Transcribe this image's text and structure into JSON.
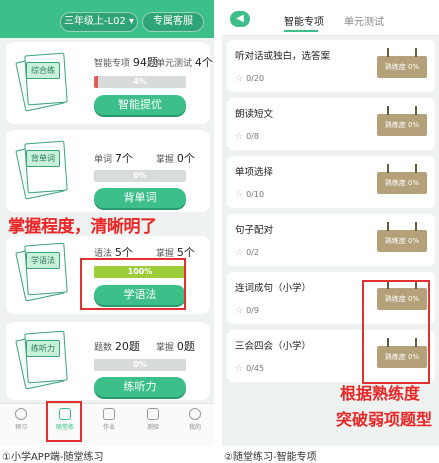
{
  "left_panel": {
    "header": {
      "grade_label": "三年级上-L02 ▾",
      "service_label": "专属客服"
    },
    "cards": [
      {
        "tag": "综合练",
        "stat1_label": "智能专项",
        "stat1_value": "94题",
        "stat2_label": "单元测试",
        "stat2_value": "4个",
        "progress": 0.04,
        "progress_label": "4%",
        "button": "智能提优"
      },
      {
        "tag": "背单词",
        "stat1_label": "单词",
        "stat1_value": "7个",
        "stat2_label": "掌握",
        "stat2_value": "0个",
        "progress": 0,
        "progress_label": "0%",
        "button": "背单词"
      },
      {
        "tag": "学语法",
        "stat1_label": "语法",
        "stat1_value": "5个",
        "stat2_label": "掌握",
        "stat2_value": "5个",
        "progress": 1.0,
        "progress_label": "100%",
        "button": "学语法"
      },
      {
        "tag": "练听力",
        "stat1_label": "题数",
        "stat1_value": "20题",
        "stat2_label": "掌握",
        "stat2_value": "0题",
        "progress": 0,
        "progress_label": "0%",
        "button": "练听力"
      }
    ],
    "overlay_text": "掌握程度，清晰明了",
    "bottom_nav": [
      {
        "label": "预习",
        "icon": "magnifier-icon"
      },
      {
        "label": "随堂练",
        "icon": "practice-icon"
      },
      {
        "label": "作业",
        "icon": "homework-icon"
      },
      {
        "label": "测验",
        "icon": "quiz-icon"
      },
      {
        "label": "我的",
        "icon": "profile-icon"
      }
    ],
    "caption": "①小学APP端-随堂练习"
  },
  "right_panel": {
    "back_icon": "arrow-left-icon",
    "tabs": [
      {
        "label": "智能专项",
        "active": true
      },
      {
        "label": "单元测试",
        "active": false
      }
    ],
    "items": [
      {
        "title": "听对话或独白，选答案",
        "count": "0/20",
        "mastery": "熟练度 0%"
      },
      {
        "title": "朗读短文",
        "count": "0/8",
        "mastery": "熟练度 0%"
      },
      {
        "title": "单项选择",
        "count": "0/10",
        "mastery": "熟练度 0%"
      },
      {
        "title": "句子配对",
        "count": "0/2",
        "mastery": "熟练度 0%"
      },
      {
        "title": "连词成句（小学）",
        "count": "0/9",
        "mastery": "熟练度 0%"
      },
      {
        "title": "三会四会（小学）",
        "count": "0/45",
        "mastery": "熟练度 0%"
      }
    ],
    "overlay_line1": "根据熟练度",
    "overlay_line2": "突破弱项题型",
    "caption": "②随堂练习-智能专项"
  },
  "colors": {
    "accent": "#3cbf89",
    "annotation": "#ea2525",
    "progress_low": "#e35a5a",
    "progress_full": "#9ccc3a",
    "board": "#b4a079"
  }
}
